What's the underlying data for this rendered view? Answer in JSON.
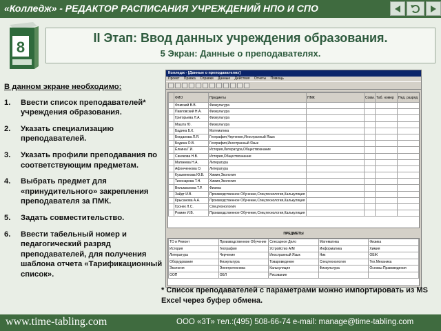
{
  "header": {
    "title_brand": "«Колледж»",
    "title_rest": " - РЕДАКТОР РАСПИСАНИЯ УЧРЕЖДЕНИЙ НПО И СПО",
    "nav_icons": [
      "back-icon",
      "return-icon",
      "forward-icon"
    ]
  },
  "slide": {
    "stage_title": "II Этап: Ввод данных учреждения образования.",
    "screen_subtitle": "5 Экран: Данные о преподавателях.",
    "intro": "В данном экране необходимо:",
    "steps": [
      {
        "num": "1.",
        "text": "Ввести список преподавателей* учреждения образования."
      },
      {
        "num": "2.",
        "text": "Указать специализацию преподавателей."
      },
      {
        "num": "3.",
        "text": "Указать профили преподавания по соответствующим предметам."
      },
      {
        "num": "4.",
        "text": "Выбрать предмет для «принудительного» закрепления преподавателя за ПМК."
      },
      {
        "num": "5.",
        "text": "Задать совместительство."
      },
      {
        "num": "6.",
        "text": "Ввести табельный номер и педагогический разряд преподавателей, для получения шаблона отчета «Тарификационный список»."
      }
    ],
    "footnote": "* Список преподавателей с параметрами можно импортировать из MS Excel через буфер обмена."
  },
  "app": {
    "window_title": "Колледж - [Данные о преподавателях]",
    "menu": [
      "Проект",
      "Правка",
      "Справки",
      "Данные",
      "Действия",
      "Отчеты",
      "Помощь"
    ],
    "columns": [
      "ФИО",
      "Предметы",
      "ПМК",
      "Совм.",
      "Таб. номер",
      "Пед. разряд"
    ],
    "rows": [
      [
        "Фомский В.В.",
        "Физкультура"
      ],
      [
        "Павловский Н.А.",
        "Физкультура"
      ],
      [
        "Григорьева Л.А.",
        "Физкультура"
      ],
      [
        "Машта Ю.",
        "Физкультура"
      ],
      [
        "Бадина Б.К.",
        "Математика"
      ],
      [
        "Богданова Л.Я.",
        "География,Черчение,Иностранный Язык"
      ],
      [
        "Бодина О.В.",
        "География,Иностранный Язык"
      ],
      [
        "Ёлкина Г.И.",
        "История,Литература,Обществознание"
      ],
      [
        "Синякова Н.В.",
        "История,Обществознание"
      ],
      [
        "Матвеева Н.А.",
        "Литература"
      ],
      [
        "Афонченкова О.",
        "Литература"
      ],
      [
        "Кузьменкова Ю.В.",
        "Химия,Экология"
      ],
      [
        "Тихонарова Т.Н.",
        "Химия,Экология"
      ],
      [
        "Вельмаскова Т.Р.",
        "Физика"
      ],
      [
        "Зайдт И.В.",
        "Производственное Обучение,Спецтехнология,Калькуляция"
      ],
      [
        "Крысанова А.А.",
        "Производственное Обучение,Спецтехнология,Калькуляция"
      ],
      [
        "Гронек Л.С.",
        "Спецтехнология"
      ],
      [
        "Рюмин И.В.",
        "Производственное Обучение,Спецтехнология,Калькуляция"
      ]
    ],
    "subjects_title": "ПРЕДМЕТЫ",
    "subjects": [
      [
        "ТО и Ремонт",
        "Производственное Обучение",
        "Слесарное Дело",
        "Математика",
        "Физика"
      ],
      [
        "История",
        "География",
        "Устройство А/М",
        "Информатика",
        "Химия"
      ],
      [
        "Литература",
        "Черчение",
        "Иностранный Язык",
        "Ник",
        "ОБЖ"
      ],
      [
        "Оборудование",
        "Физкультура",
        "Товароведение",
        "Спецтехнология",
        "Тех.Механика"
      ],
      [
        "Экология",
        "Электротехника",
        "Калькуляция",
        "Физкультура",
        "Основы Правоведения"
      ],
      [
        "ООП",
        "ОБЛ",
        "Рисование",
        "",
        ""
      ]
    ]
  },
  "footer": {
    "site": "www.time-tabling.com",
    "contacts": "ООО «3Т»   тел.:(495) 508-66-74   e-mail: manage@time-tabling.com"
  }
}
